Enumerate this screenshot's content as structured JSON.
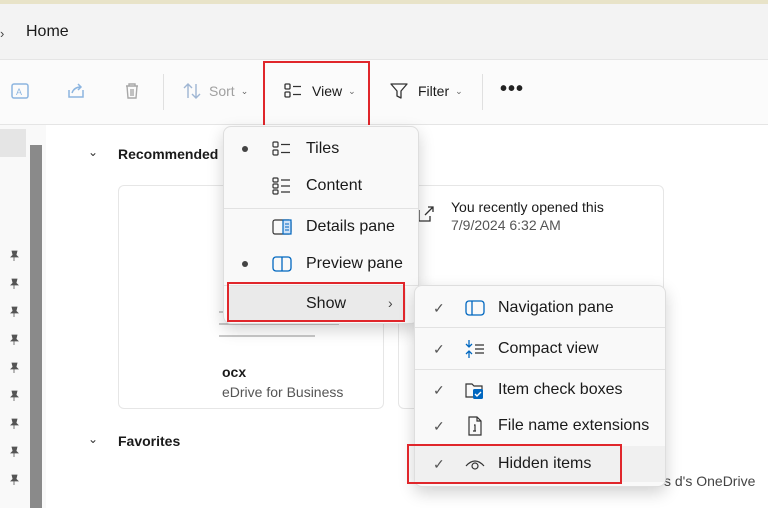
{
  "address": {
    "chevron": "›",
    "location": "Home"
  },
  "toolbar": {
    "sort_label": "Sort",
    "view_label": "View",
    "filter_label": "Filter",
    "more_label": "•••",
    "caret": "⌄"
  },
  "sections": {
    "recommended": "Recommended",
    "favorites": "Favorites"
  },
  "card1": {
    "filename": "ocx",
    "location": "eDrive for Business"
  },
  "card2": {
    "activity": "You recently opened this",
    "datetime": "7/9/2024 6:32 AM"
  },
  "bottom_text": "s d's OneDrive",
  "view_menu": {
    "items": [
      {
        "label": "Tiles",
        "icon": "tiles-icon",
        "selected": true
      },
      {
        "label": "Content",
        "icon": "content-icon",
        "selected": false
      },
      {
        "label": "Details pane",
        "icon": "details-pane-icon",
        "selected": false
      },
      {
        "label": "Preview pane",
        "icon": "preview-pane-icon",
        "selected": true
      },
      {
        "label": "Show",
        "icon": "",
        "selected": false
      }
    ],
    "submenu_arrow": "›"
  },
  "show_menu": {
    "check": "✓",
    "items": [
      {
        "label": "Navigation pane",
        "icon": "navigation-pane-icon",
        "checked": true
      },
      {
        "label": "Compact view",
        "icon": "compact-view-icon",
        "checked": true
      },
      {
        "label": "Item check boxes",
        "icon": "item-check-boxes-icon",
        "checked": true
      },
      {
        "label": "File name extensions",
        "icon": "file-name-extensions-icon",
        "checked": true
      },
      {
        "label": "Hidden items",
        "icon": "eye-icon",
        "checked": true
      }
    ]
  },
  "colors": {
    "highlight": "#e0262b",
    "accent": "#0067c0"
  }
}
